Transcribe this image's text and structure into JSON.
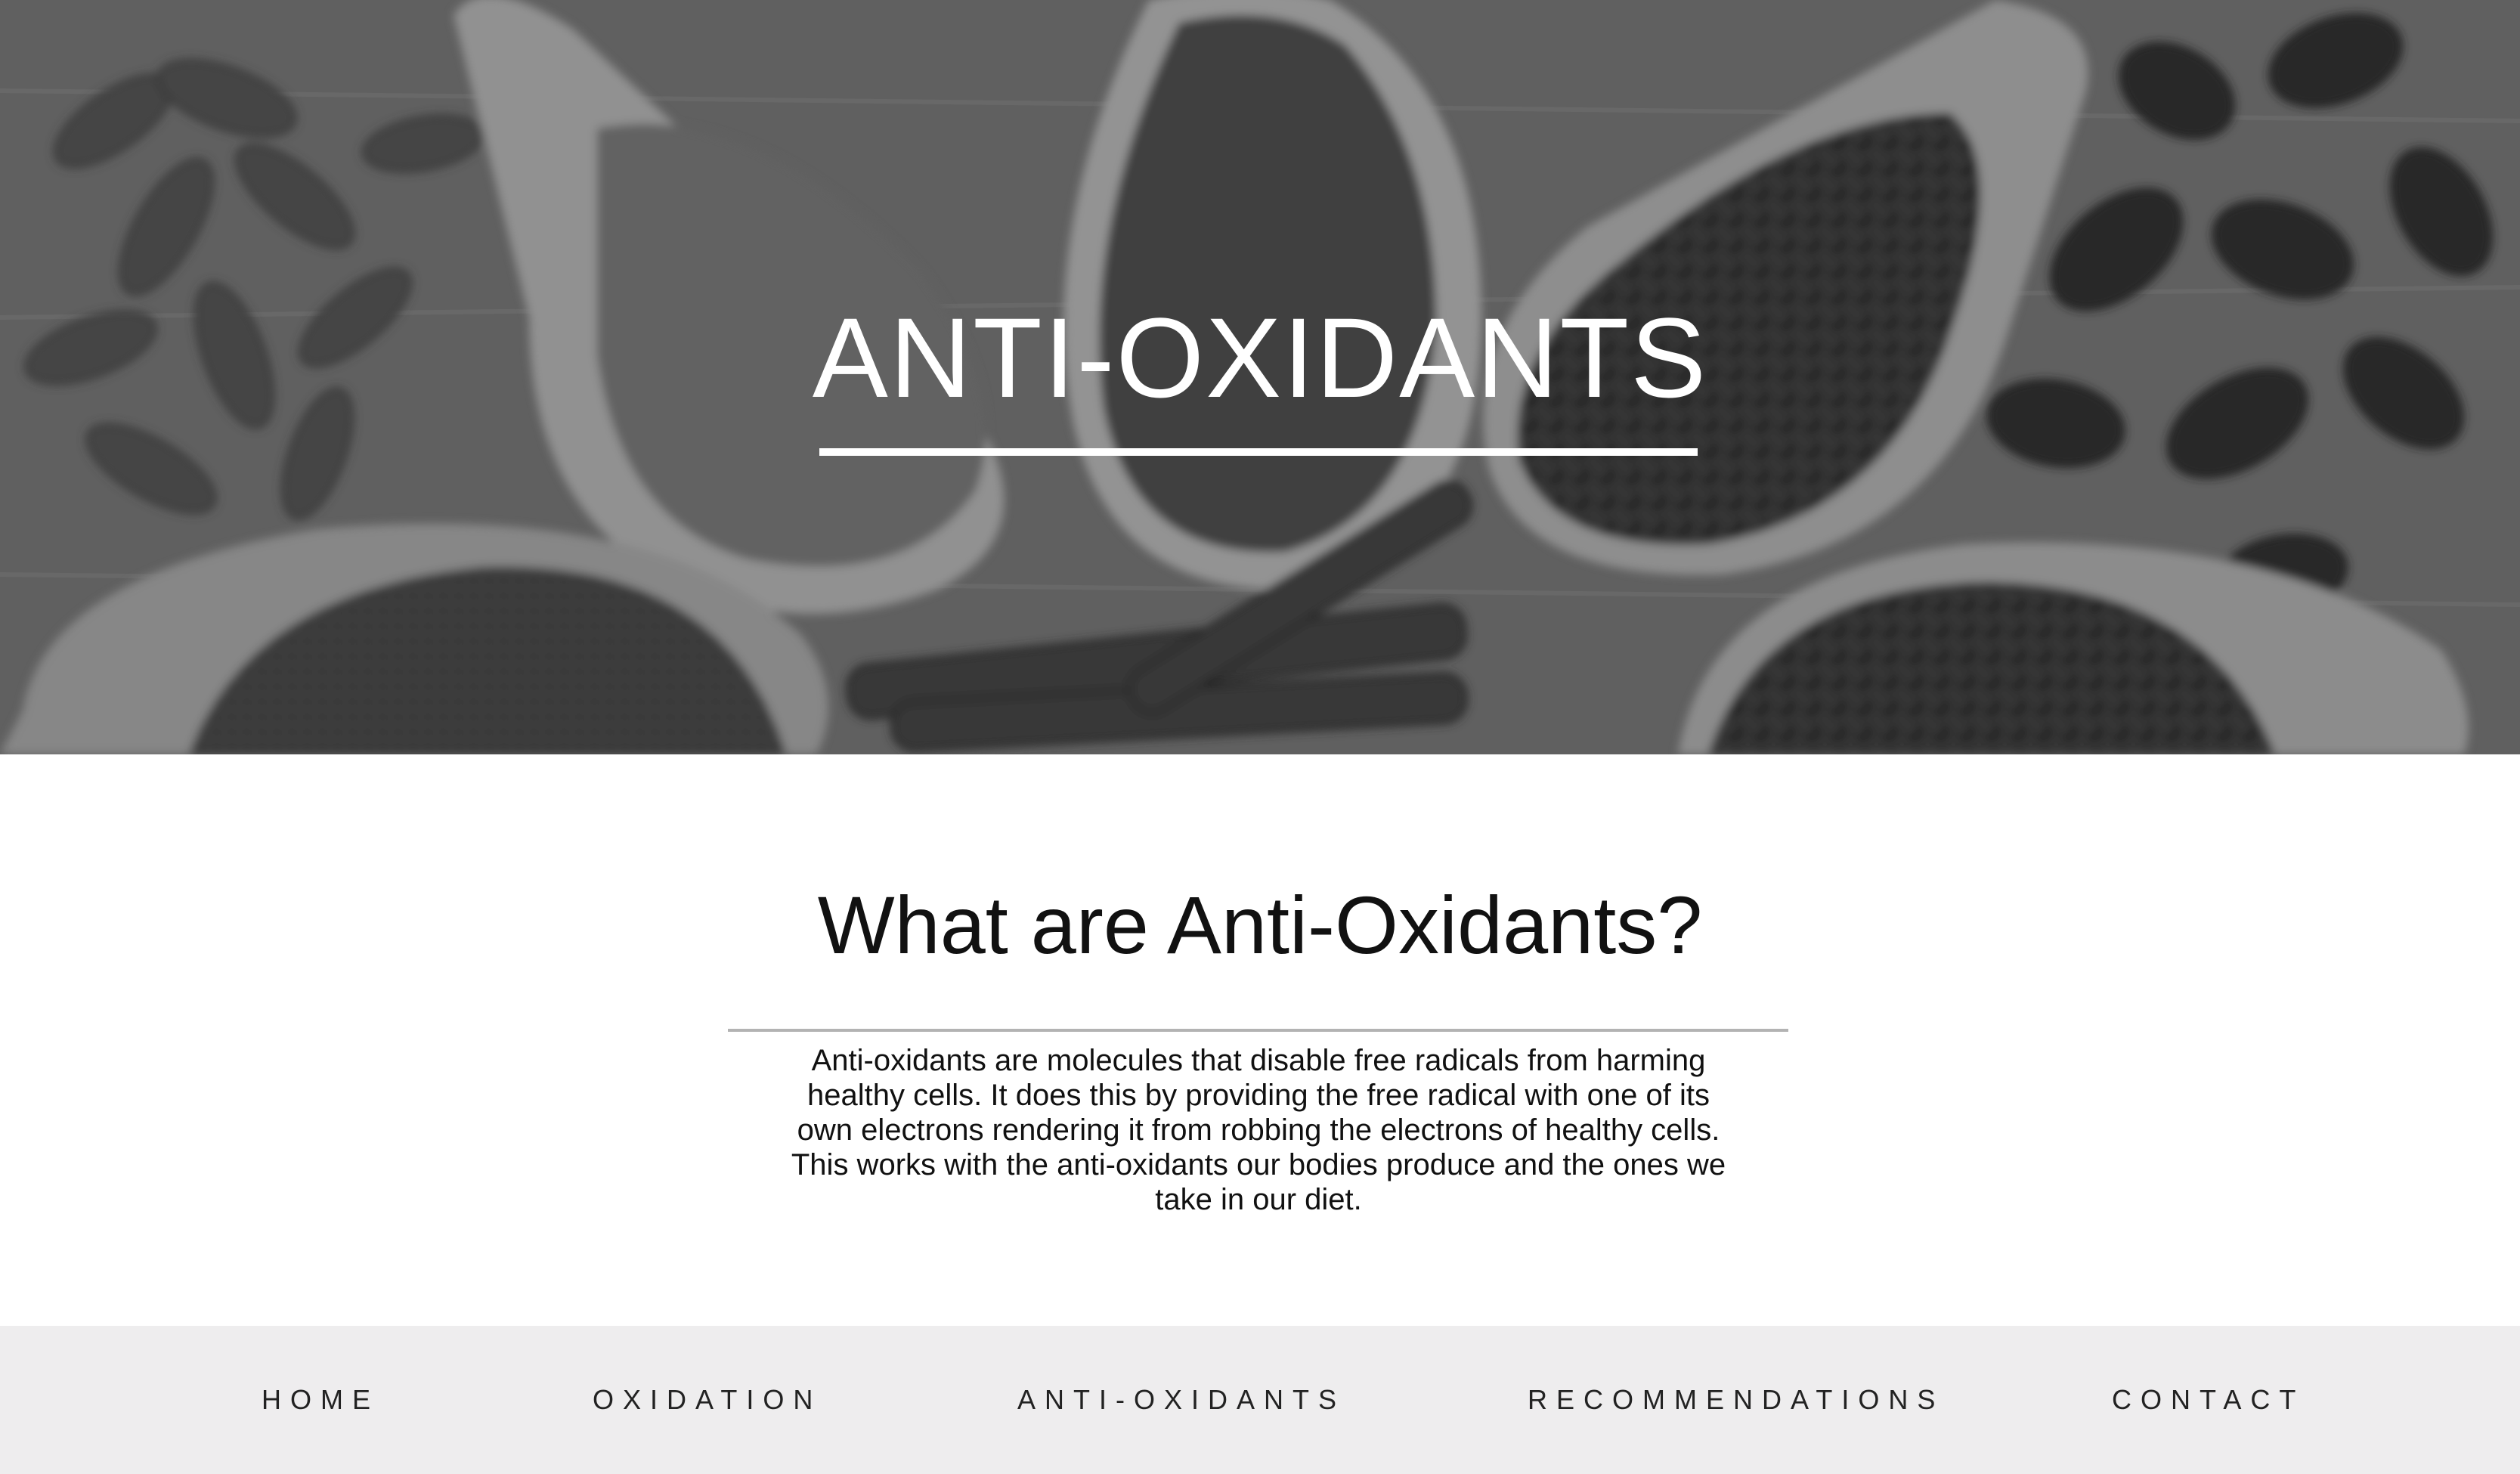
{
  "hero": {
    "title": "ANTI-OXIDANTS",
    "image": "spices-in-spoons-background"
  },
  "section": {
    "title": "What are Anti-Oxidants?",
    "body": "Anti-oxidants are molecules that disable free radicals from harming healthy cells. It does this by providing the free radical with one of its own electrons rendering it from robbing the electrons of healthy cells. This works with the anti-oxidants our bodies produce and the ones we take in our diet."
  },
  "nav": {
    "items": [
      {
        "label": "HOME"
      },
      {
        "label": "OXIDATION"
      },
      {
        "label": "ANTI-OXIDANTS"
      },
      {
        "label": "RECOMMENDATIONS"
      },
      {
        "label": "CONTACT"
      }
    ]
  },
  "colors": {
    "nav_background": "#eeedee",
    "hero_text": "#ffffff",
    "rule": "#b3b3b3"
  }
}
